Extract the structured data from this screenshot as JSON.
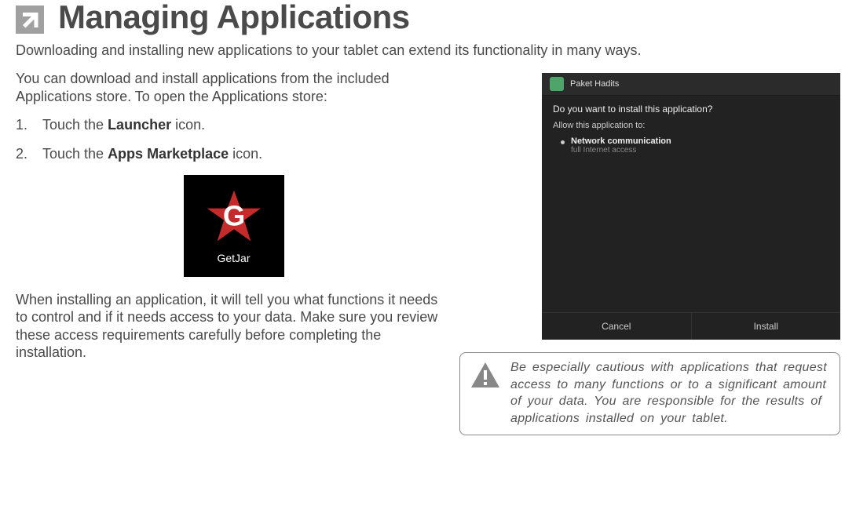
{
  "title": "Managing Applications",
  "intro": "Downloading and installing new applications to your tablet can extend its functionality in many ways.",
  "para_store": "You can download and install applications from the included Applications store. To open the Applications store:",
  "steps": {
    "s1_pre": "Touch the ",
    "s1_bold": "Launcher",
    "s1_post": " icon.",
    "s2_pre": "Touch the ",
    "s2_bold": "Apps Marketplace",
    "s2_post": " icon."
  },
  "getjar_label": "GetJar",
  "para_installing": "When installing an application, it will tell you what functions it needs to control and if it needs access to your data. Make sure you review these access requirements carefully before completing the installation.",
  "phone": {
    "app_name": "Paket Hadits",
    "question": "Do you want to install this application?",
    "allow_label": "Allow this application to:",
    "perm_title": "Network communication",
    "perm_sub": "full Internet access",
    "cancel": "Cancel",
    "install": "Install"
  },
  "caution_text": "Be especially cautious with applications that request access to many functions or to a significant amount of your data. You are responsible for the results of applications installed on your tablet."
}
